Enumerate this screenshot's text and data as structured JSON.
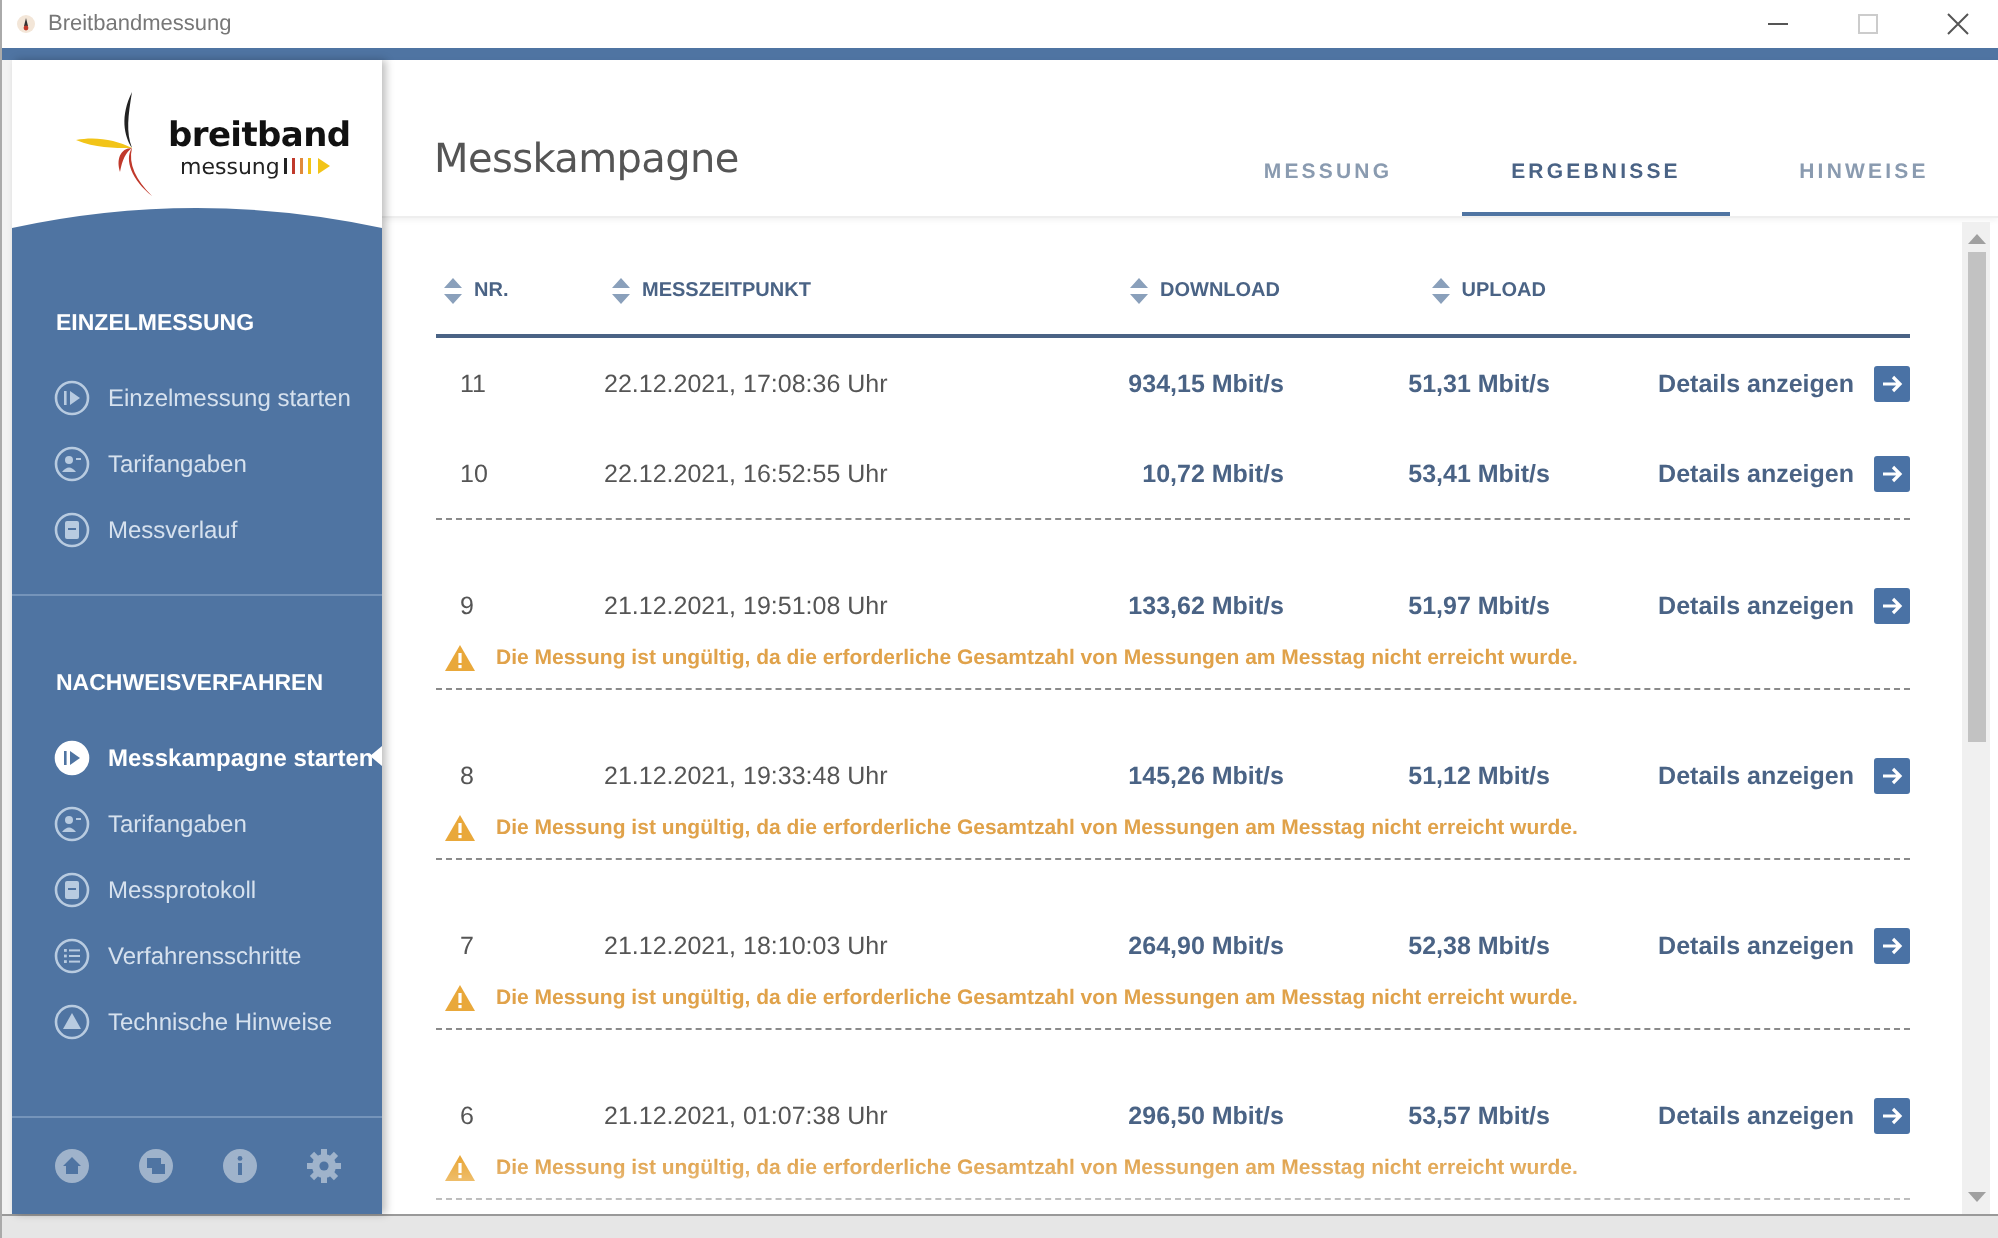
{
  "window": {
    "title": "Breitbandmessung"
  },
  "logo": {
    "line1": "breitband",
    "line2": "messung"
  },
  "sidebar": {
    "sections": [
      {
        "heading": "EINZELMESSUNG",
        "items": [
          {
            "label": "Einzelmessung starten",
            "selected": false
          },
          {
            "label": "Tarifangaben",
            "selected": false
          },
          {
            "label": "Messverlauf",
            "selected": false
          }
        ]
      },
      {
        "heading": "NACHWEISVERFAHREN",
        "items": [
          {
            "label": "Messkampagne starten",
            "selected": true
          },
          {
            "label": "Tarifangaben",
            "selected": false
          },
          {
            "label": "Messprotokoll",
            "selected": false
          },
          {
            "label": "Verfahrensschritte",
            "selected": false
          },
          {
            "label": "Technische Hinweise",
            "selected": false
          }
        ]
      }
    ]
  },
  "page_title": "Messkampagne",
  "tabs": [
    {
      "label": "MESSUNG",
      "selected": false
    },
    {
      "label": "ERGEBNISSE",
      "selected": true
    },
    {
      "label": "HINWEISE",
      "selected": false
    }
  ],
  "table": {
    "columns": [
      "NR.",
      "MESSZEITPUNKT",
      "DOWNLOAD",
      "UPLOAD"
    ],
    "rows": [
      {
        "nr": "11",
        "time": "22.12.2021, 17:08:36 Uhr",
        "download": "934,15 Mbit/s",
        "upload": "51,31 Mbit/s",
        "action": "Details anzeigen"
      },
      {
        "nr": "10",
        "time": "22.12.2021, 16:52:55 Uhr",
        "download": "10,72 Mbit/s",
        "upload": "53,41 Mbit/s",
        "action": "Details anzeigen"
      },
      {
        "nr": "9",
        "time": "21.12.2021, 19:51:08 Uhr",
        "download": "133,62 Mbit/s",
        "upload": "51,97 Mbit/s",
        "action": "Details anzeigen",
        "warning": "Die Messung ist ungültig, da die erforderliche Gesamtzahl von Messungen am Messtag nicht erreicht wurde."
      },
      {
        "nr": "8",
        "time": "21.12.2021, 19:33:48 Uhr",
        "download": "145,26 Mbit/s",
        "upload": "51,12 Mbit/s",
        "action": "Details anzeigen",
        "warning": "Die Messung ist ungültig, da die erforderliche Gesamtzahl von Messungen am Messtag nicht erreicht wurde."
      },
      {
        "nr": "7",
        "time": "21.12.2021, 18:10:03 Uhr",
        "download": "264,90 Mbit/s",
        "upload": "52,38 Mbit/s",
        "action": "Details anzeigen",
        "warning": "Die Messung ist ungültig, da die erforderliche Gesamtzahl von Messungen am Messtag nicht erreicht wurde."
      },
      {
        "nr": "6",
        "time": "21.12.2021, 01:07:38 Uhr",
        "download": "296,50 Mbit/s",
        "upload": "53,57 Mbit/s",
        "action": "Details anzeigen",
        "warning": "Die Messung ist ungültig, da die erforderliche Gesamtzahl von Messungen am Messtag nicht erreicht wurde."
      }
    ]
  }
}
